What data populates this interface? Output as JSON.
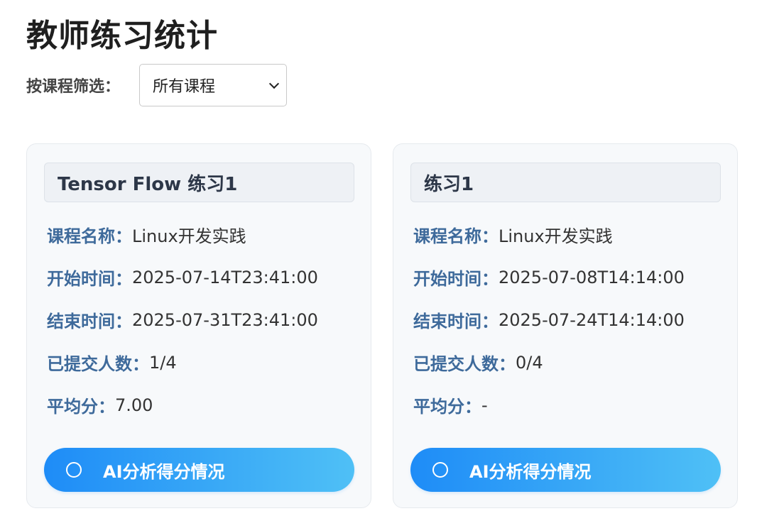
{
  "page": {
    "title": "教师练习统计"
  },
  "filter": {
    "label": "按课程筛选：",
    "selected": "所有课程"
  },
  "labels": {
    "course": "课程名称：",
    "start": "开始时间：",
    "end": "结束时间：",
    "submitted": "已提交人数：",
    "average": "平均分："
  },
  "cards": [
    {
      "title": "Tensor Flow 练习1",
      "course": "Linux开发实践",
      "start": "2025-07-14T23:41:00",
      "end": "2025-07-31T23:41:00",
      "submitted": "1/4",
      "average": "7.00",
      "button": "AI分析得分情况"
    },
    {
      "title": "练习1",
      "course": "Linux开发实践",
      "start": "2025-07-08T14:14:00",
      "end": "2025-07-24T14:14:00",
      "submitted": "0/4",
      "average": "-",
      "button": "AI分析得分情况"
    }
  ],
  "colors": {
    "accent_start": "#1e8cf7",
    "accent_end": "#4fc0f6",
    "label": "#3e6a9b"
  },
  "icons": {
    "select": "chevron-down-icon",
    "button": "circle-icon"
  }
}
